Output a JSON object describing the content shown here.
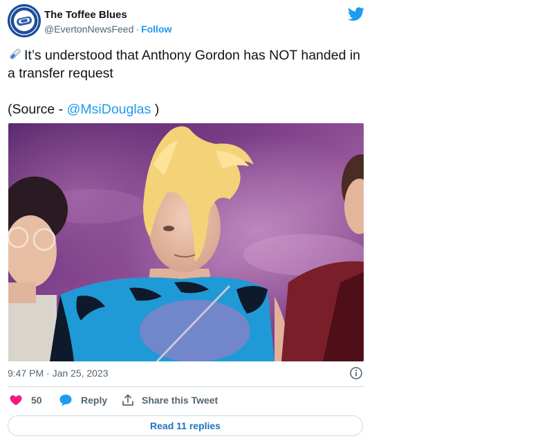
{
  "author": {
    "name": "The Toffee Blues",
    "handle": "@EvertonNewsFeed",
    "separator": "·",
    "follow_label": "Follow"
  },
  "tweet": {
    "line1": "It’s understood that Anthony Gordon has NOT handed in a transfer request",
    "source_prefix": "(Source - ",
    "mention": "@MsiDouglas",
    "source_suffix": " )",
    "timestamp": "9:47 PM · Jan 25, 2023"
  },
  "actions": {
    "like_count": "50",
    "reply_label": "Reply",
    "share_label": "Share this Tweet"
  },
  "read_replies_label": "Read 11 replies",
  "icons": {
    "brand": "twitter-bird-icon",
    "emoji": "syringe-pill-icon",
    "info": "info-icon",
    "like": "heart-icon",
    "reply": "speech-bubble-icon",
    "share": "share-upload-icon"
  },
  "colors": {
    "accent": "#1d9bf0",
    "like": "#f91880",
    "text_secondary": "#536471",
    "border": "#cfd9de"
  }
}
